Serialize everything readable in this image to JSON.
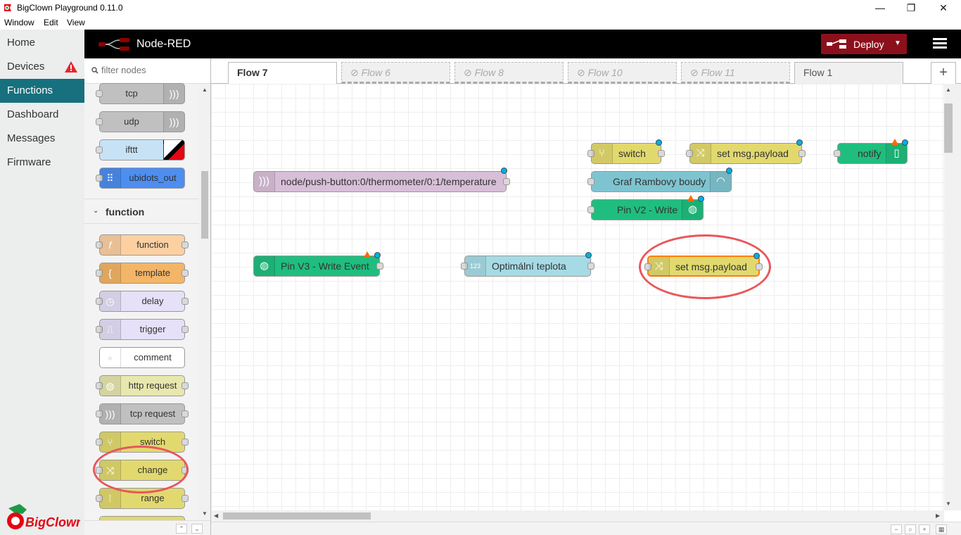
{
  "window": {
    "title": "BigClown Playground 0.11.0",
    "minimize": "—",
    "maximize": "❐",
    "close": "✕"
  },
  "menu": [
    "Window",
    "Edit",
    "View"
  ],
  "app_nav": {
    "items": [
      {
        "label": "Home"
      },
      {
        "label": "Devices"
      },
      {
        "label": "Functions"
      },
      {
        "label": "Dashboard"
      },
      {
        "label": "Messages"
      },
      {
        "label": "Firmware"
      }
    ],
    "active": "Functions"
  },
  "nodered": {
    "brand": "Node-RED",
    "deploy_label": "Deploy"
  },
  "palette": {
    "filter_placeholder": "filter nodes",
    "network_nodes": [
      "tcp",
      "udp",
      "ifttt",
      "ubidots_out"
    ],
    "category": "function",
    "function_nodes": [
      "function",
      "template",
      "delay",
      "trigger",
      "comment",
      "http request",
      "tcp request",
      "switch",
      "change",
      "range"
    ]
  },
  "tabs": [
    {
      "label": "Flow 7",
      "state": "active"
    },
    {
      "label": "Flow 6",
      "state": "disabled"
    },
    {
      "label": "Flow 8",
      "state": "disabled"
    },
    {
      "label": "Flow 10",
      "state": "disabled"
    },
    {
      "label": "Flow 11",
      "state": "disabled"
    },
    {
      "label": "Flow 1",
      "state": "normal"
    }
  ],
  "add_tab": "+",
  "flow_nodes": {
    "switch": "switch",
    "set_payload_1": "set msg.payload",
    "notify": "notify",
    "mqtt_in": "node/push-button:0/thermometer/0:1/temperature",
    "graf": "Graf Rambovy boudy",
    "pin_v2": "Pin V2 - Write",
    "pin_v3": "Pin V3 - Write Event",
    "optimal": "Optimální teplota",
    "set_payload_2": "set msg.payload"
  },
  "colors": {
    "accent": "#17707d",
    "deploy": "#8c101c",
    "function_yellow": "#e2d96e",
    "mqtt_purple": "#d8bfd8",
    "blynk_green": "#1fbe7e",
    "dashboard_blue": "#7ec4d0",
    "inject_blue": "#a6dbe5",
    "template_orange": "#f3b567",
    "function_orange": "#fdd0a2",
    "delay_lavender": "#e6e0f8",
    "network_grey": "#c0c0c0",
    "annotation": "#e9575b"
  }
}
